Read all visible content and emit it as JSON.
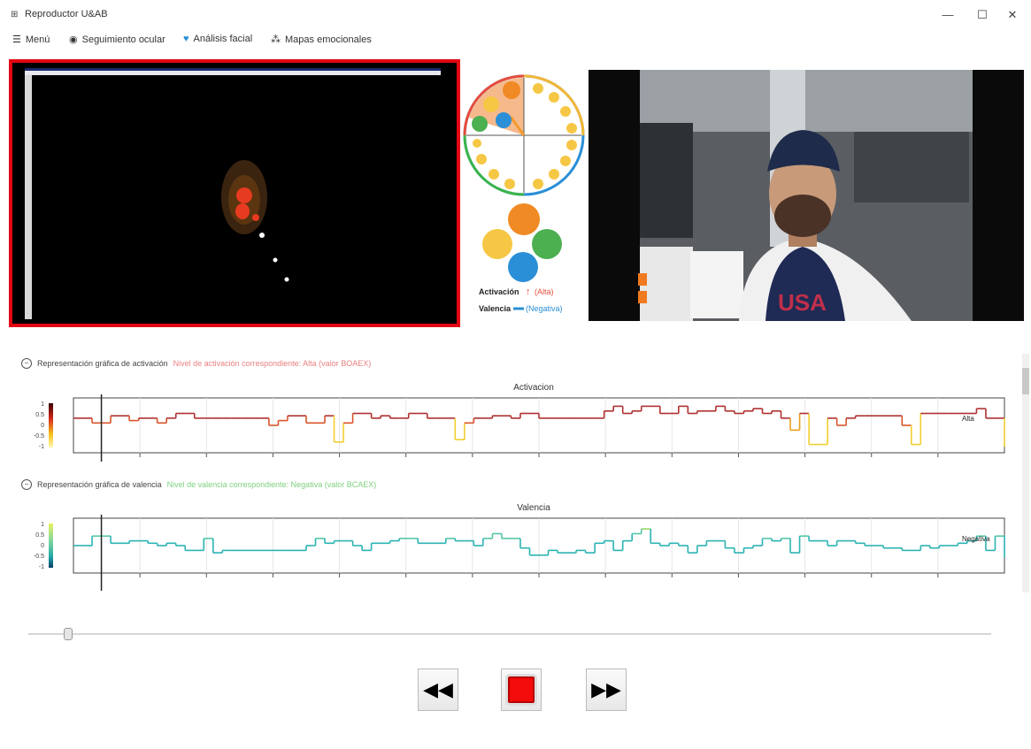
{
  "window": {
    "title": "Reproductor U&AB",
    "minimize": "—",
    "maximize": "☐",
    "close": "✕",
    "icon": "app-icon"
  },
  "menu": {
    "items": [
      {
        "label": "Menú",
        "icon": "hamburger-icon"
      },
      {
        "label": "Seguimiento ocular",
        "icon": "eye-icon"
      },
      {
        "label": "Análisis facial",
        "icon": "heart-icon"
      },
      {
        "label": "Mapas emocionales",
        "icon": "map-icon"
      }
    ]
  },
  "wheel_legend": {
    "activation_label": "Activación",
    "activation_value": "(Alta)",
    "valence_label": "Valencia",
    "valence_value": "(Negativa)"
  },
  "sections": {
    "activation": {
      "heading": "Representación gráfica de activación",
      "note": "Nivel de activación correspondiente: Alta (valor BOAEX)"
    },
    "valence": {
      "heading": "Representación gráfica de valencia",
      "note": "Nivel de valencia correspondiente: Negativa (valor BCAEX)"
    }
  },
  "colors": {
    "accent_red": "#e30613",
    "activation_line": "#b03030",
    "valence_line": "#2bb3b3",
    "wheel_blue": "#2a8fd6",
    "wheel_orange": "#f29a2e"
  },
  "chart_data": [
    {
      "type": "line",
      "title": "Activacion",
      "ylim": [
        -1,
        1
      ],
      "y_ticks": [
        "1",
        "0.5",
        "0",
        "-0.5",
        "-1"
      ],
      "legend_label": "Alta",
      "cursor_x": 0.03,
      "x": [
        0,
        0.01,
        0.02,
        0.03,
        0.04,
        0.05,
        0.06,
        0.07,
        0.08,
        0.09,
        0.1,
        0.11,
        0.12,
        0.13,
        0.14,
        0.15,
        0.16,
        0.17,
        0.18,
        0.19,
        0.2,
        0.21,
        0.22,
        0.23,
        0.24,
        0.25,
        0.26,
        0.27,
        0.28,
        0.29,
        0.3,
        0.31,
        0.32,
        0.33,
        0.34,
        0.35,
        0.36,
        0.37,
        0.38,
        0.39,
        0.4,
        0.41,
        0.42,
        0.43,
        0.44,
        0.45,
        0.46,
        0.47,
        0.48,
        0.49,
        0.5,
        0.51,
        0.52,
        0.53,
        0.54,
        0.55,
        0.56,
        0.57,
        0.58,
        0.59,
        0.6,
        0.61,
        0.62,
        0.63,
        0.64,
        0.65,
        0.66,
        0.67,
        0.68,
        0.69,
        0.7,
        0.71,
        0.72,
        0.73,
        0.74,
        0.75,
        0.76,
        0.77,
        0.78,
        0.79,
        0.8,
        0.81,
        0.82,
        0.83,
        0.84,
        0.85,
        0.86,
        0.87,
        0.88,
        0.89,
        0.9,
        0.91,
        0.92,
        0.93,
        0.94,
        0.95,
        0.96,
        0.97,
        0.98,
        0.99,
        1.0
      ],
      "values": [
        0.3,
        0.3,
        0.1,
        0.1,
        0.4,
        0.4,
        0.2,
        0.3,
        0.3,
        0.1,
        0.3,
        0.5,
        0.5,
        0.3,
        0.3,
        0.3,
        0.3,
        0.3,
        0.3,
        0.3,
        0.3,
        0.0,
        0.2,
        0.4,
        0.4,
        0.1,
        0.1,
        0.4,
        -0.7,
        0.1,
        0.5,
        0.5,
        0.3,
        0.4,
        0.3,
        0.3,
        0.5,
        0.5,
        0.3,
        0.3,
        0.3,
        -0.6,
        0.1,
        0.3,
        0.3,
        0.4,
        0.4,
        0.3,
        0.5,
        0.5,
        0.3,
        0.3,
        0.3,
        0.3,
        0.3,
        0.3,
        0.3,
        0.6,
        0.8,
        0.5,
        0.6,
        0.8,
        0.8,
        0.5,
        0.5,
        0.8,
        0.5,
        0.6,
        0.6,
        0.8,
        0.6,
        0.5,
        0.6,
        0.7,
        0.5,
        0.6,
        0.3,
        -0.2,
        0.5,
        -0.8,
        -0.8,
        0.3,
        0.0,
        0.3,
        0.4,
        0.4,
        0.4,
        0.4,
        0.4,
        0.0,
        -0.8,
        0.5,
        0.5,
        0.5,
        0.5,
        0.5,
        0.5,
        0.7,
        0.3,
        0.3,
        -0.9
      ]
    },
    {
      "type": "line",
      "title": "Valencia",
      "ylim": [
        -1,
        1
      ],
      "y_ticks": [
        "1",
        "0.5",
        "0",
        "-0.5",
        "-1"
      ],
      "legend_label": "Negativa",
      "cursor_x": 0.03,
      "x": [
        0,
        0.01,
        0.02,
        0.03,
        0.04,
        0.05,
        0.06,
        0.07,
        0.08,
        0.09,
        0.1,
        0.11,
        0.12,
        0.13,
        0.14,
        0.15,
        0.16,
        0.17,
        0.18,
        0.19,
        0.2,
        0.21,
        0.22,
        0.23,
        0.24,
        0.25,
        0.26,
        0.27,
        0.28,
        0.29,
        0.3,
        0.31,
        0.32,
        0.33,
        0.34,
        0.35,
        0.36,
        0.37,
        0.38,
        0.39,
        0.4,
        0.41,
        0.42,
        0.43,
        0.44,
        0.45,
        0.46,
        0.47,
        0.48,
        0.49,
        0.5,
        0.51,
        0.52,
        0.53,
        0.54,
        0.55,
        0.56,
        0.57,
        0.58,
        0.59,
        0.6,
        0.61,
        0.62,
        0.63,
        0.64,
        0.65,
        0.66,
        0.67,
        0.68,
        0.69,
        0.7,
        0.71,
        0.72,
        0.73,
        0.74,
        0.75,
        0.76,
        0.77,
        0.78,
        0.79,
        0.8,
        0.81,
        0.82,
        0.83,
        0.84,
        0.85,
        0.86,
        0.87,
        0.88,
        0.89,
        0.9,
        0.91,
        0.92,
        0.93,
        0.94,
        0.95,
        0.96,
        0.97,
        0.98,
        0.99,
        1.0
      ],
      "values": [
        0.0,
        0.0,
        0.4,
        0.4,
        0.1,
        0.1,
        0.2,
        0.2,
        0.1,
        0.0,
        0.1,
        0.0,
        -0.2,
        -0.2,
        0.3,
        -0.3,
        -0.2,
        -0.2,
        -0.2,
        -0.2,
        -0.2,
        -0.2,
        -0.2,
        -0.2,
        -0.2,
        0.0,
        0.3,
        0.1,
        0.2,
        0.2,
        0.0,
        -0.2,
        0.1,
        0.1,
        0.2,
        0.3,
        0.3,
        0.1,
        0.1,
        0.1,
        0.3,
        0.2,
        0.2,
        0.0,
        0.3,
        0.5,
        0.3,
        0.3,
        -0.1,
        -0.4,
        -0.4,
        -0.2,
        -0.3,
        -0.3,
        -0.2,
        -0.3,
        0.1,
        0.2,
        -0.2,
        0.2,
        0.5,
        0.7,
        0.1,
        0.0,
        0.1,
        0.0,
        -0.3,
        0.0,
        0.2,
        0.2,
        -0.1,
        -0.3,
        -0.1,
        0.0,
        0.3,
        0.2,
        0.3,
        -0.3,
        0.4,
        0.2,
        0.2,
        0.0,
        0.2,
        0.2,
        0.1,
        0.0,
        0.0,
        -0.1,
        -0.1,
        -0.2,
        -0.2,
        0.0,
        -0.1,
        0.0,
        0.0,
        0.1,
        0.2,
        0.4,
        -0.2,
        0.4,
        -0.5
      ]
    }
  ]
}
